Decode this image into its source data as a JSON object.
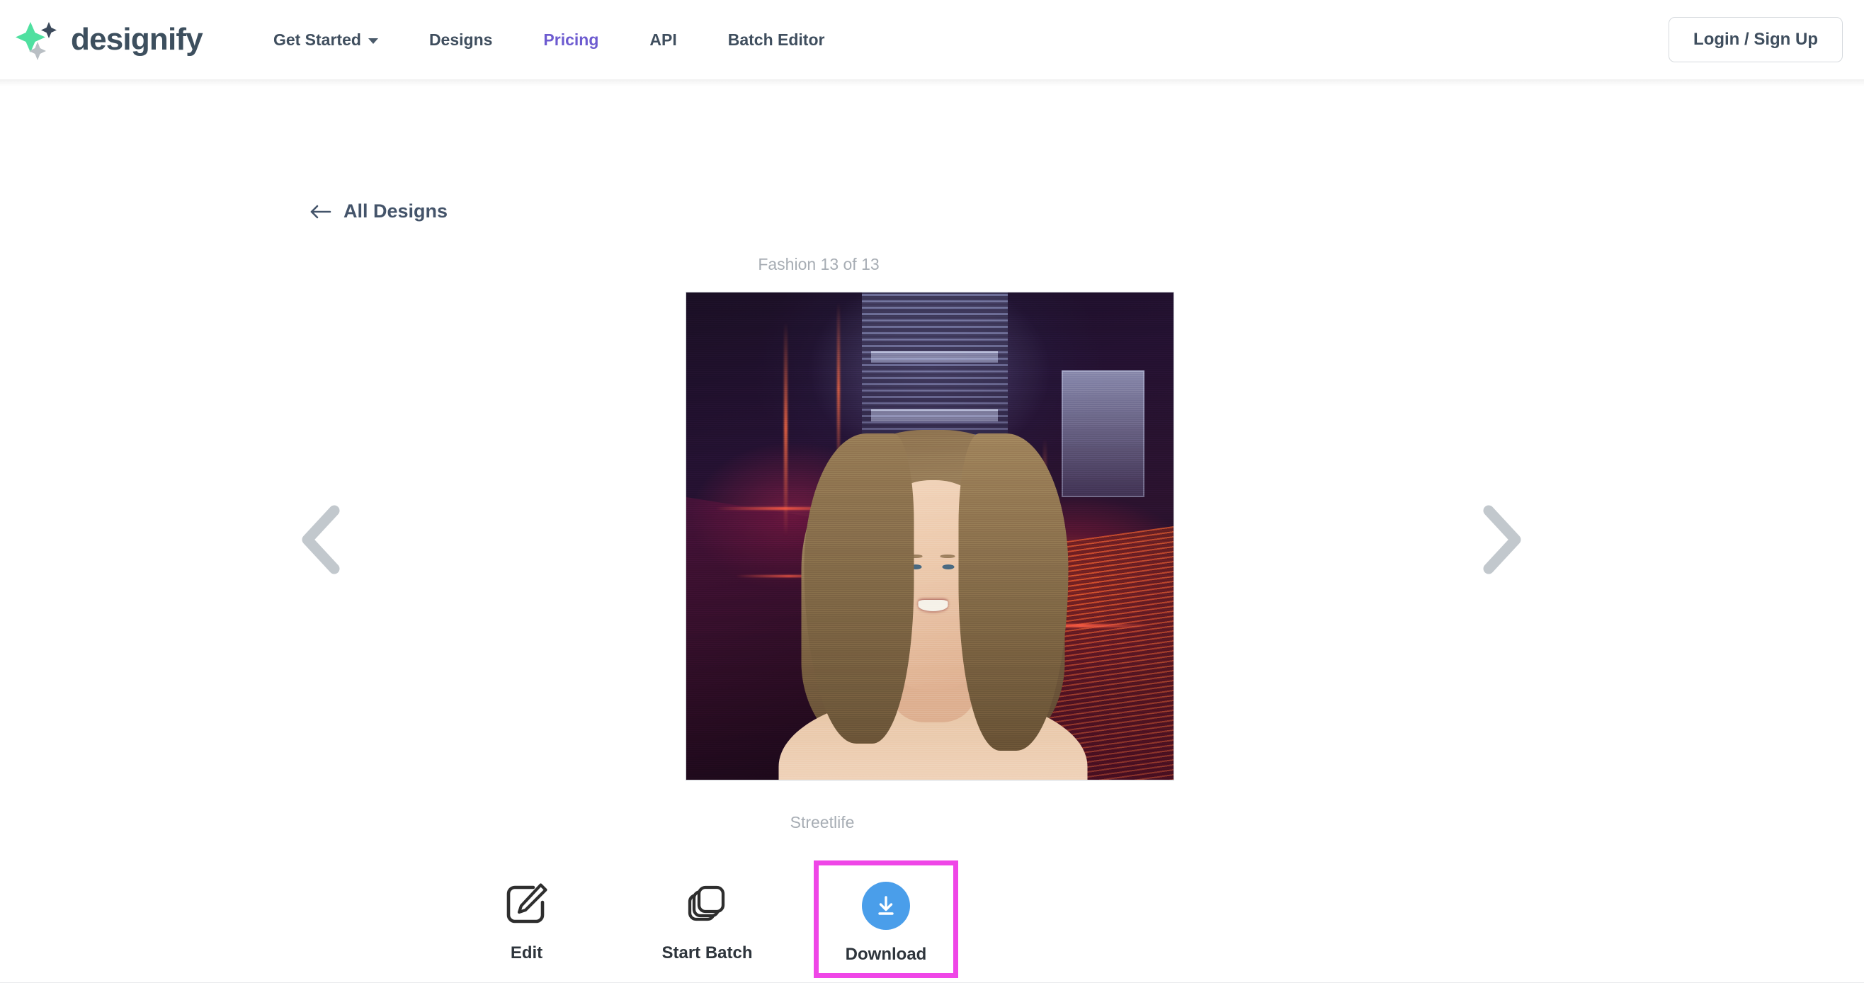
{
  "header": {
    "brand_name": "designify",
    "logo_icon": "sparkle-diamond-logo",
    "logo_colors": {
      "primary": "#4fe0a0",
      "secondary": "#3c4a5c",
      "tertiary": "#b9bfc4"
    },
    "nav": [
      {
        "label": "Get Started",
        "has_dropdown": true,
        "accent": false
      },
      {
        "label": "Designs",
        "has_dropdown": false,
        "accent": false
      },
      {
        "label": "Pricing",
        "has_dropdown": false,
        "accent": true
      },
      {
        "label": "API",
        "has_dropdown": false,
        "accent": false
      },
      {
        "label": "Batch Editor",
        "has_dropdown": false,
        "accent": false
      }
    ],
    "login_label": "Login / Sign Up"
  },
  "back_link": {
    "label": "All Designs",
    "icon": "arrow-left-icon"
  },
  "viewer": {
    "counter": "Fashion 13 of 13",
    "design_title": "Streetlife",
    "prev_icon": "chevron-left-icon",
    "next_icon": "chevron-right-icon",
    "arrow_color": "#c2c8cd",
    "image_alt": "Smiling woman with long blonde hair on a neon-lit dark alley background"
  },
  "actions": [
    {
      "label": "Edit",
      "icon": "pencil-square-icon",
      "highlighted": false
    },
    {
      "label": "Start Batch",
      "icon": "layers-stack-icon",
      "highlighted": false
    },
    {
      "label": "Download",
      "icon": "download-arrow-icon",
      "highlighted": true
    }
  ],
  "highlight_color": "#ef46e7",
  "download_button_color": "#4a9eea"
}
